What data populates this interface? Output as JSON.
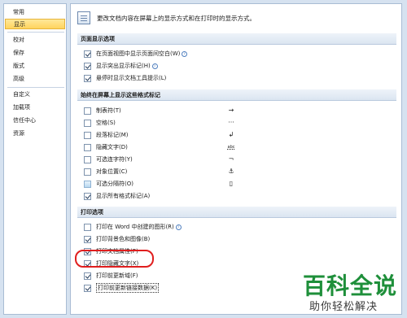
{
  "sidebar": {
    "items": [
      {
        "label": "常用",
        "selected": false
      },
      {
        "label": "显示",
        "selected": true
      },
      {
        "label": "校对",
        "selected": false
      },
      {
        "label": "保存",
        "selected": false
      },
      {
        "label": "版式",
        "selected": false
      },
      {
        "label": "高级",
        "selected": false
      },
      {
        "label": "自定义",
        "selected": false
      },
      {
        "label": "加载项",
        "selected": false
      },
      {
        "label": "信任中心",
        "selected": false
      },
      {
        "label": "资源",
        "selected": false
      }
    ]
  },
  "intro": {
    "text": "更改文档内容在屏幕上的显示方式和在打印时的显示方式。",
    "icon": "document-display-icon"
  },
  "page_display": {
    "header": "页面显示选项",
    "options": [
      {
        "label": "在页面视图中显示页面间空白(W)",
        "checked": true,
        "info": true
      },
      {
        "label": "显示突出显示标记(H)",
        "checked": true,
        "info": true
      },
      {
        "label": "悬停时显示文档工具提示(L)",
        "checked": true,
        "info": false
      }
    ]
  },
  "formatting_marks": {
    "header": "始终在屏幕上显示这些格式标记",
    "options": [
      {
        "label": "制表符(T)",
        "checked": false,
        "mark": "→"
      },
      {
        "label": "空格(S)",
        "checked": false,
        "mark": "···"
      },
      {
        "label": "段落标记(M)",
        "checked": false,
        "mark": "↲"
      },
      {
        "label": "隐藏文字(D)",
        "checked": false,
        "mark": "abc"
      },
      {
        "label": "可选连字符(Y)",
        "checked": false,
        "mark": "¬"
      },
      {
        "label": "对象位置(C)",
        "checked": false,
        "mark": "⚓"
      },
      {
        "label": "可选分隔符(O)",
        "checked": false,
        "mark": "▯"
      },
      {
        "label": "显示所有格式标记(A)",
        "checked": true,
        "mark": ""
      }
    ]
  },
  "print": {
    "header": "打印选项",
    "options": [
      {
        "label": "打印在 Word 中创建的图形(R)",
        "checked": false,
        "info": true
      },
      {
        "label": "打印背景色和图像(B)",
        "checked": true,
        "info": false
      },
      {
        "label": "打印文档属性(P)",
        "checked": true,
        "info": false
      },
      {
        "label": "打印隐藏文字(X)",
        "checked": true,
        "info": false
      },
      {
        "label": "打印前更新域(F)",
        "checked": true,
        "info": false
      },
      {
        "label": "打印前更新链接数据(K)",
        "checked": true,
        "info": false
      }
    ]
  },
  "watermark": {
    "title": "百科全说",
    "subtitle": "助你轻松解决"
  },
  "colors": {
    "highlight_ring": "#e01e1e",
    "watermark_green": "#1e8f3a",
    "selected_nav": "#ffd45e"
  }
}
